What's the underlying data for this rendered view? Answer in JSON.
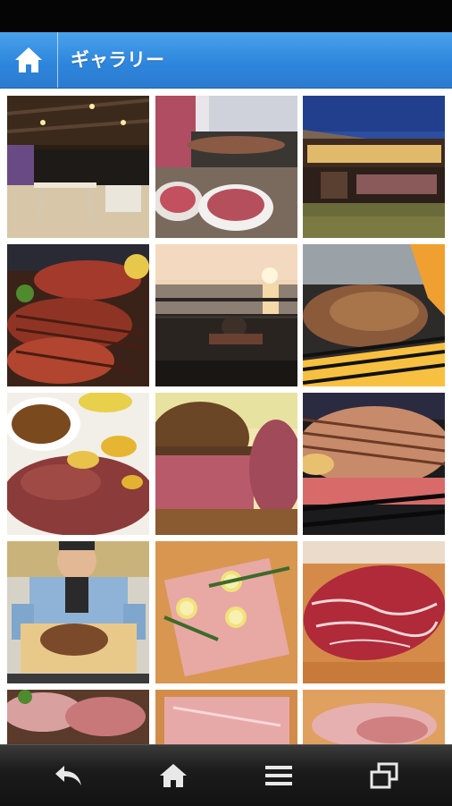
{
  "header": {
    "title": "ギャラリー",
    "home_icon": "home-icon"
  },
  "gallery": {
    "items": [
      {
        "subject": "outdoor-terrace-dining"
      },
      {
        "subject": "grilling-meat-plates"
      },
      {
        "subject": "building-at-dusk"
      },
      {
        "subject": "steaks-on-grill"
      },
      {
        "subject": "sunset-over-sea"
      },
      {
        "subject": "steaks-flame-grill"
      },
      {
        "subject": "sliced-steak-with-sauce"
      },
      {
        "subject": "steak-cross-section"
      },
      {
        "subject": "steak-on-grill-closeup"
      },
      {
        "subject": "chef-holding-steak"
      },
      {
        "subject": "raw-meat-with-lemon"
      },
      {
        "subject": "marbled-raw-steak"
      },
      {
        "subject": "raw-meat-partial"
      },
      {
        "subject": "raw-meat-on-board-partial"
      },
      {
        "subject": "raw-meat-partial-2"
      }
    ]
  },
  "bottom_nav": {
    "icons": [
      "back-icon",
      "home-icon",
      "menu-icon",
      "windows-icon"
    ]
  },
  "colors": {
    "header_blue": "#3b92e4",
    "status_bar": "#050505",
    "bottom_bar": "#1c1c1c"
  }
}
